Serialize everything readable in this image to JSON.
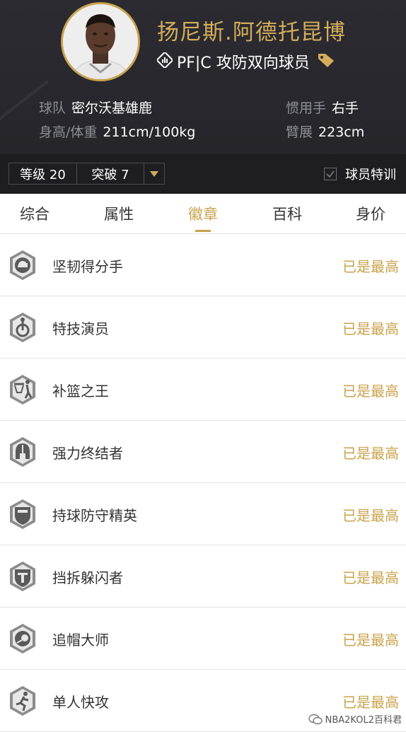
{
  "player": {
    "name": "扬尼斯.阿德托昆博",
    "position_text": "PF|C 攻防双向球员",
    "team_label": "球队",
    "team_value": "密尔沃基雄鹿",
    "height_weight_label": "身高/体重",
    "height_weight_value": "211cm/100kg",
    "hand_label": "惯用手",
    "hand_value": "右手",
    "wingspan_label": "臂展",
    "wingspan_value": "223cm"
  },
  "controls": {
    "level": "等级 20",
    "breakthrough": "突破 7",
    "special_training": "球员特训"
  },
  "tabs": [
    {
      "label": "综合",
      "active": false
    },
    {
      "label": "属性",
      "active": false
    },
    {
      "label": "徽章",
      "active": true
    },
    {
      "label": "百科",
      "active": false
    },
    {
      "label": "身价",
      "active": false
    }
  ],
  "badges": [
    {
      "name": "坚韧得分手",
      "status": "已是最高",
      "icon": "tough-scorer-icon"
    },
    {
      "name": "特技演员",
      "status": "已是最高",
      "icon": "acrobat-icon"
    },
    {
      "name": "补篮之王",
      "status": "已是最高",
      "icon": "putback-king-icon"
    },
    {
      "name": "强力终结者",
      "status": "已是最高",
      "icon": "strong-finisher-icon"
    },
    {
      "name": "持球防守精英",
      "status": "已是最高",
      "icon": "ball-defense-elite-icon"
    },
    {
      "name": "挡拆躲闪者",
      "status": "已是最高",
      "icon": "pick-dodger-icon"
    },
    {
      "name": "追帽大师",
      "status": "已是最高",
      "icon": "chase-down-master-icon"
    },
    {
      "name": "单人快攻",
      "status": "已是最高",
      "icon": "one-man-fastbreak-icon"
    }
  ],
  "watermark": "NBA2KOL2百科君",
  "colors": {
    "gold": "#c9a24b",
    "header_bg": "#2b2b31",
    "bar_bg": "#1e1e22"
  }
}
